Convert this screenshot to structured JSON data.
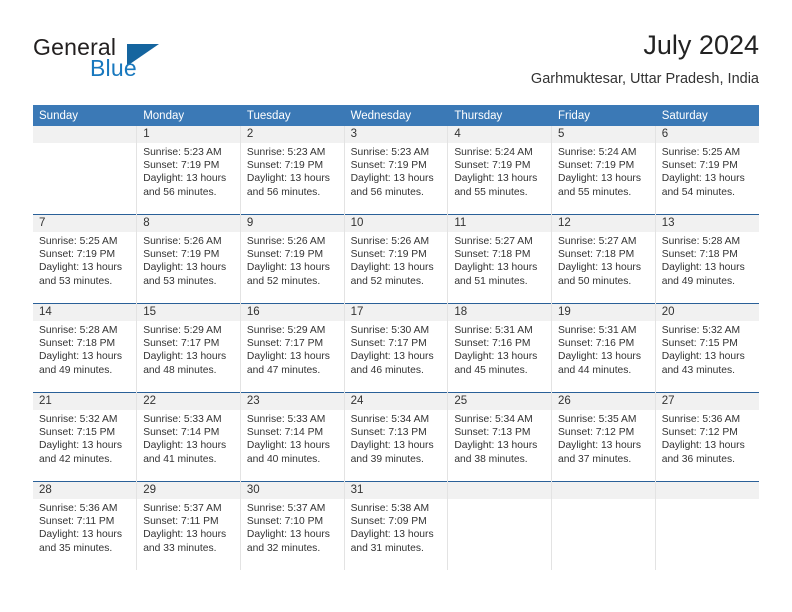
{
  "brand": {
    "name_primary": "General",
    "name_secondary": "Blue",
    "triangle_icon": "triangle-icon"
  },
  "header": {
    "title": "July 2024",
    "subtitle": "Garhmuktesar, Uttar Pradesh, India"
  },
  "calendar": {
    "weekday_headers": [
      "Sunday",
      "Monday",
      "Tuesday",
      "Wednesday",
      "Thursday",
      "Friday",
      "Saturday"
    ],
    "colors": {
      "header_blue": "#3b79b6",
      "row_divider_blue": "#2a6098",
      "daynum_band": "#f1f1f1",
      "brand_blue": "#1878be"
    },
    "weeks": [
      {
        "days": [
          {
            "number": "",
            "sunrise": "",
            "sunset": "",
            "daylight_line1": "",
            "daylight_line2": "",
            "empty": true
          },
          {
            "number": "1",
            "sunrise": "Sunrise: 5:23 AM",
            "sunset": "Sunset: 7:19 PM",
            "daylight_line1": "Daylight: 13 hours",
            "daylight_line2": "and 56 minutes."
          },
          {
            "number": "2",
            "sunrise": "Sunrise: 5:23 AM",
            "sunset": "Sunset: 7:19 PM",
            "daylight_line1": "Daylight: 13 hours",
            "daylight_line2": "and 56 minutes."
          },
          {
            "number": "3",
            "sunrise": "Sunrise: 5:23 AM",
            "sunset": "Sunset: 7:19 PM",
            "daylight_line1": "Daylight: 13 hours",
            "daylight_line2": "and 56 minutes."
          },
          {
            "number": "4",
            "sunrise": "Sunrise: 5:24 AM",
            "sunset": "Sunset: 7:19 PM",
            "daylight_line1": "Daylight: 13 hours",
            "daylight_line2": "and 55 minutes."
          },
          {
            "number": "5",
            "sunrise": "Sunrise: 5:24 AM",
            "sunset": "Sunset: 7:19 PM",
            "daylight_line1": "Daylight: 13 hours",
            "daylight_line2": "and 55 minutes."
          },
          {
            "number": "6",
            "sunrise": "Sunrise: 5:25 AM",
            "sunset": "Sunset: 7:19 PM",
            "daylight_line1": "Daylight: 13 hours",
            "daylight_line2": "and 54 minutes."
          }
        ]
      },
      {
        "days": [
          {
            "number": "7",
            "sunrise": "Sunrise: 5:25 AM",
            "sunset": "Sunset: 7:19 PM",
            "daylight_line1": "Daylight: 13 hours",
            "daylight_line2": "and 53 minutes."
          },
          {
            "number": "8",
            "sunrise": "Sunrise: 5:26 AM",
            "sunset": "Sunset: 7:19 PM",
            "daylight_line1": "Daylight: 13 hours",
            "daylight_line2": "and 53 minutes."
          },
          {
            "number": "9",
            "sunrise": "Sunrise: 5:26 AM",
            "sunset": "Sunset: 7:19 PM",
            "daylight_line1": "Daylight: 13 hours",
            "daylight_line2": "and 52 minutes."
          },
          {
            "number": "10",
            "sunrise": "Sunrise: 5:26 AM",
            "sunset": "Sunset: 7:19 PM",
            "daylight_line1": "Daylight: 13 hours",
            "daylight_line2": "and 52 minutes."
          },
          {
            "number": "11",
            "sunrise": "Sunrise: 5:27 AM",
            "sunset": "Sunset: 7:18 PM",
            "daylight_line1": "Daylight: 13 hours",
            "daylight_line2": "and 51 minutes."
          },
          {
            "number": "12",
            "sunrise": "Sunrise: 5:27 AM",
            "sunset": "Sunset: 7:18 PM",
            "daylight_line1": "Daylight: 13 hours",
            "daylight_line2": "and 50 minutes."
          },
          {
            "number": "13",
            "sunrise": "Sunrise: 5:28 AM",
            "sunset": "Sunset: 7:18 PM",
            "daylight_line1": "Daylight: 13 hours",
            "daylight_line2": "and 49 minutes."
          }
        ]
      },
      {
        "days": [
          {
            "number": "14",
            "sunrise": "Sunrise: 5:28 AM",
            "sunset": "Sunset: 7:18 PM",
            "daylight_line1": "Daylight: 13 hours",
            "daylight_line2": "and 49 minutes."
          },
          {
            "number": "15",
            "sunrise": "Sunrise: 5:29 AM",
            "sunset": "Sunset: 7:17 PM",
            "daylight_line1": "Daylight: 13 hours",
            "daylight_line2": "and 48 minutes."
          },
          {
            "number": "16",
            "sunrise": "Sunrise: 5:29 AM",
            "sunset": "Sunset: 7:17 PM",
            "daylight_line1": "Daylight: 13 hours",
            "daylight_line2": "and 47 minutes."
          },
          {
            "number": "17",
            "sunrise": "Sunrise: 5:30 AM",
            "sunset": "Sunset: 7:17 PM",
            "daylight_line1": "Daylight: 13 hours",
            "daylight_line2": "and 46 minutes."
          },
          {
            "number": "18",
            "sunrise": "Sunrise: 5:31 AM",
            "sunset": "Sunset: 7:16 PM",
            "daylight_line1": "Daylight: 13 hours",
            "daylight_line2": "and 45 minutes."
          },
          {
            "number": "19",
            "sunrise": "Sunrise: 5:31 AM",
            "sunset": "Sunset: 7:16 PM",
            "daylight_line1": "Daylight: 13 hours",
            "daylight_line2": "and 44 minutes."
          },
          {
            "number": "20",
            "sunrise": "Sunrise: 5:32 AM",
            "sunset": "Sunset: 7:15 PM",
            "daylight_line1": "Daylight: 13 hours",
            "daylight_line2": "and 43 minutes."
          }
        ]
      },
      {
        "days": [
          {
            "number": "21",
            "sunrise": "Sunrise: 5:32 AM",
            "sunset": "Sunset: 7:15 PM",
            "daylight_line1": "Daylight: 13 hours",
            "daylight_line2": "and 42 minutes."
          },
          {
            "number": "22",
            "sunrise": "Sunrise: 5:33 AM",
            "sunset": "Sunset: 7:14 PM",
            "daylight_line1": "Daylight: 13 hours",
            "daylight_line2": "and 41 minutes."
          },
          {
            "number": "23",
            "sunrise": "Sunrise: 5:33 AM",
            "sunset": "Sunset: 7:14 PM",
            "daylight_line1": "Daylight: 13 hours",
            "daylight_line2": "and 40 minutes."
          },
          {
            "number": "24",
            "sunrise": "Sunrise: 5:34 AM",
            "sunset": "Sunset: 7:13 PM",
            "daylight_line1": "Daylight: 13 hours",
            "daylight_line2": "and 39 minutes."
          },
          {
            "number": "25",
            "sunrise": "Sunrise: 5:34 AM",
            "sunset": "Sunset: 7:13 PM",
            "daylight_line1": "Daylight: 13 hours",
            "daylight_line2": "and 38 minutes."
          },
          {
            "number": "26",
            "sunrise": "Sunrise: 5:35 AM",
            "sunset": "Sunset: 7:12 PM",
            "daylight_line1": "Daylight: 13 hours",
            "daylight_line2": "and 37 minutes."
          },
          {
            "number": "27",
            "sunrise": "Sunrise: 5:36 AM",
            "sunset": "Sunset: 7:12 PM",
            "daylight_line1": "Daylight: 13 hours",
            "daylight_line2": "and 36 minutes."
          }
        ]
      },
      {
        "days": [
          {
            "number": "28",
            "sunrise": "Sunrise: 5:36 AM",
            "sunset": "Sunset: 7:11 PM",
            "daylight_line1": "Daylight: 13 hours",
            "daylight_line2": "and 35 minutes."
          },
          {
            "number": "29",
            "sunrise": "Sunrise: 5:37 AM",
            "sunset": "Sunset: 7:11 PM",
            "daylight_line1": "Daylight: 13 hours",
            "daylight_line2": "and 33 minutes."
          },
          {
            "number": "30",
            "sunrise": "Sunrise: 5:37 AM",
            "sunset": "Sunset: 7:10 PM",
            "daylight_line1": "Daylight: 13 hours",
            "daylight_line2": "and 32 minutes."
          },
          {
            "number": "31",
            "sunrise": "Sunrise: 5:38 AM",
            "sunset": "Sunset: 7:09 PM",
            "daylight_line1": "Daylight: 13 hours",
            "daylight_line2": "and 31 minutes."
          },
          {
            "number": "",
            "sunrise": "",
            "sunset": "",
            "daylight_line1": "",
            "daylight_line2": "",
            "empty": true
          },
          {
            "number": "",
            "sunrise": "",
            "sunset": "",
            "daylight_line1": "",
            "daylight_line2": "",
            "empty": true
          },
          {
            "number": "",
            "sunrise": "",
            "sunset": "",
            "daylight_line1": "",
            "daylight_line2": "",
            "empty": true
          }
        ]
      }
    ]
  }
}
